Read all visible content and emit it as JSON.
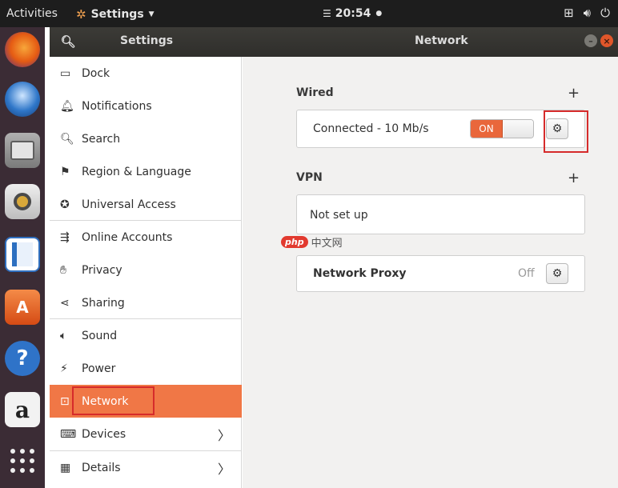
{
  "topbar": {
    "activities": "Activities",
    "app_menu": "Settings",
    "clock": "20:54"
  },
  "header": {
    "sidebar_title": "Settings",
    "main_title": "Network"
  },
  "sidebar": {
    "items": [
      {
        "label": "Dock",
        "icon": "dock-icon"
      },
      {
        "label": "Notifications",
        "icon": "bell-icon"
      },
      {
        "label": "Search",
        "icon": "search-icon"
      },
      {
        "label": "Region & Language",
        "icon": "region-flag-icon"
      },
      {
        "label": "Universal Access",
        "icon": "accessibility-icon"
      },
      {
        "label": "Online Accounts",
        "icon": "online-accounts-icon"
      },
      {
        "label": "Privacy",
        "icon": "hand-icon"
      },
      {
        "label": "Sharing",
        "icon": "share-icon"
      },
      {
        "label": "Sound",
        "icon": "speaker-icon"
      },
      {
        "label": "Power",
        "icon": "power-plug-icon"
      },
      {
        "label": "Network",
        "icon": "network-icon"
      },
      {
        "label": "Devices",
        "icon": "devices-icon"
      },
      {
        "label": "Details",
        "icon": "info-icon"
      }
    ],
    "active": "Network"
  },
  "main": {
    "wired": {
      "title": "Wired",
      "status": "Connected - 10 Mb/s",
      "toggle_label": "ON"
    },
    "vpn": {
      "title": "VPN",
      "status": "Not set up"
    },
    "proxy": {
      "title": "Network Proxy",
      "status": "Off"
    }
  },
  "watermark": {
    "badge": "php",
    "text": "中文网"
  },
  "colors": {
    "accent": "#f07746",
    "toggle_on": "#e9673b",
    "highlight_box": "#d62b2b",
    "dock_bg": "#3b2c35"
  }
}
